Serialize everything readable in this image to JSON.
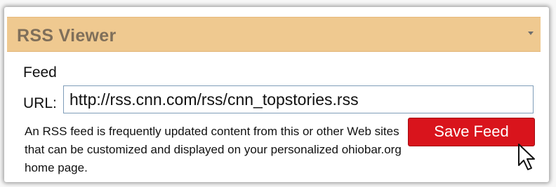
{
  "widget": {
    "title": "RSS Viewer",
    "collapse_icon": "chevron-down-icon"
  },
  "form": {
    "feed_label": "Feed",
    "url_label": "URL:",
    "url_value": "http://rss.cnn.com/rss/cnn_topstories.rss",
    "description": "An RSS feed is frequently updated content from this or other Web sites that can be customized and displayed on your personalized ohiobar.org home page.",
    "save_button_label": "Save Feed"
  },
  "cursor": {
    "icon": "pointer-cursor-icon"
  },
  "colors": {
    "header_bg": "#efc990",
    "header_text": "#7f6f5a",
    "button_bg": "#d9141c",
    "button_text": "#ffffff"
  }
}
